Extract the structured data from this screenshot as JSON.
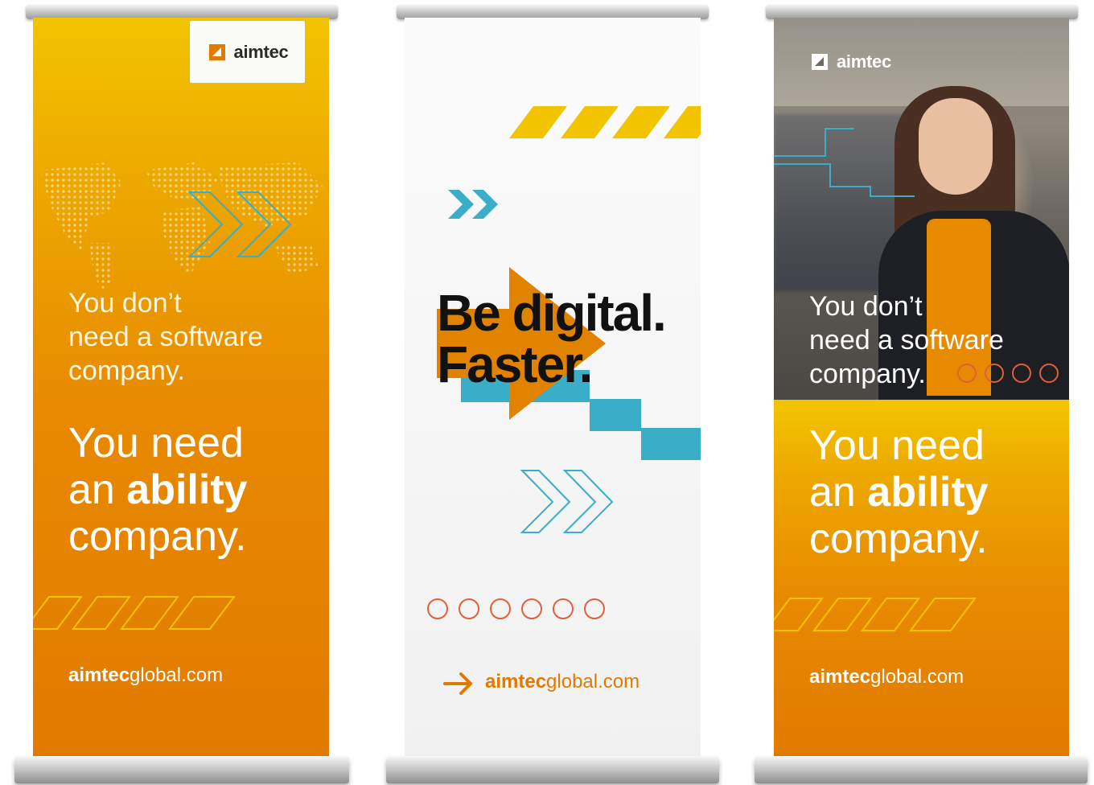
{
  "brand": {
    "name": "aimtec",
    "orange": "#e88a00",
    "yellow": "#f2c400",
    "teal": "#3aaec8",
    "dark": "#111111"
  },
  "banner_left": {
    "logo_text": "aimtec",
    "line1": "You don’t",
    "line2": "need a software",
    "line3": "company.",
    "big1": "You need",
    "big2_pre": "an ",
    "big2_bold": "ability",
    "big3": "company.",
    "url_bold": "aimtec",
    "url_rest": "global.com"
  },
  "banner_middle": {
    "headline1": "Be digital.",
    "headline2": "Faster.",
    "url_bold": "aimtec",
    "url_rest": "global.com",
    "arrow_icon": "arrow-right-icon"
  },
  "banner_right": {
    "logo_text": "aimtec",
    "line1": "You don’t",
    "line2": "need a software",
    "line3": "company.",
    "big1": "You need",
    "big2_pre": "an ",
    "big2_bold": "ability",
    "big3": "company.",
    "url_bold": "aimtec",
    "url_rest": "global.com"
  }
}
